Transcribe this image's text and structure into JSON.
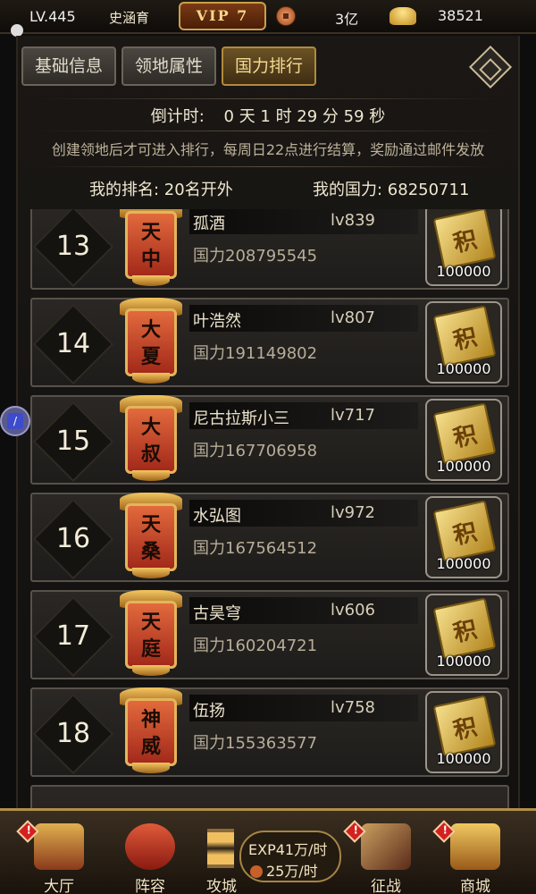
{
  "topbar": {
    "level": "LV.445",
    "player_name": "史涵育",
    "vip": "VIP 7",
    "coin_value": "3亿",
    "ingot_value": "38521",
    "coin_icon": "copper-coin-icon",
    "ingot_icon": "gold-ingot-icon"
  },
  "tabs": [
    {
      "label": "基础信息",
      "active": false
    },
    {
      "label": "领地属性",
      "active": false
    },
    {
      "label": "国力排行",
      "active": true
    }
  ],
  "countdown": {
    "label": "倒计时:",
    "value": "0 天 1 时 29 分 59 秒"
  },
  "notice": "创建领地后才可进入排行，每周日22点进行结算，奖励通过邮件发放",
  "my_rank": "我的排名: 20名开外",
  "my_power": "我的国力: 68250711",
  "ranking": [
    {
      "rank": "13",
      "badge": [
        "天",
        "中"
      ],
      "name": "孤酒",
      "level": "lv839",
      "power": "国力208795545",
      "reward_glyph": "积",
      "reward_qty": "100000"
    },
    {
      "rank": "14",
      "badge": [
        "大",
        "夏"
      ],
      "name": "叶浩然",
      "level": "lv807",
      "power": "国力191149802",
      "reward_glyph": "积",
      "reward_qty": "100000"
    },
    {
      "rank": "15",
      "badge": [
        "大",
        "叔"
      ],
      "name": "尼古拉斯小三",
      "level": "lv717",
      "power": "国力167706958",
      "reward_glyph": "积",
      "reward_qty": "100000"
    },
    {
      "rank": "16",
      "badge": [
        "天",
        "桑"
      ],
      "name": "水弘图",
      "level": "lv972",
      "power": "国力167564512",
      "reward_glyph": "积",
      "reward_qty": "100000"
    },
    {
      "rank": "17",
      "badge": [
        "天",
        "庭"
      ],
      "name": "古昊穹",
      "level": "lv606",
      "power": "国力160204721",
      "reward_glyph": "积",
      "reward_qty": "100000"
    },
    {
      "rank": "18",
      "badge": [
        "神",
        "威"
      ],
      "name": "伍扬",
      "level": "lv758",
      "power": "国力155363577",
      "reward_glyph": "积",
      "reward_qty": "100000"
    }
  ],
  "bottom_nav": {
    "hall": "大厅",
    "lineup": "阵容",
    "siege": "攻城",
    "exp_rate": "EXP41万/时",
    "coin_rate": "25万/时",
    "campaign": "征战",
    "shop": "商城"
  }
}
